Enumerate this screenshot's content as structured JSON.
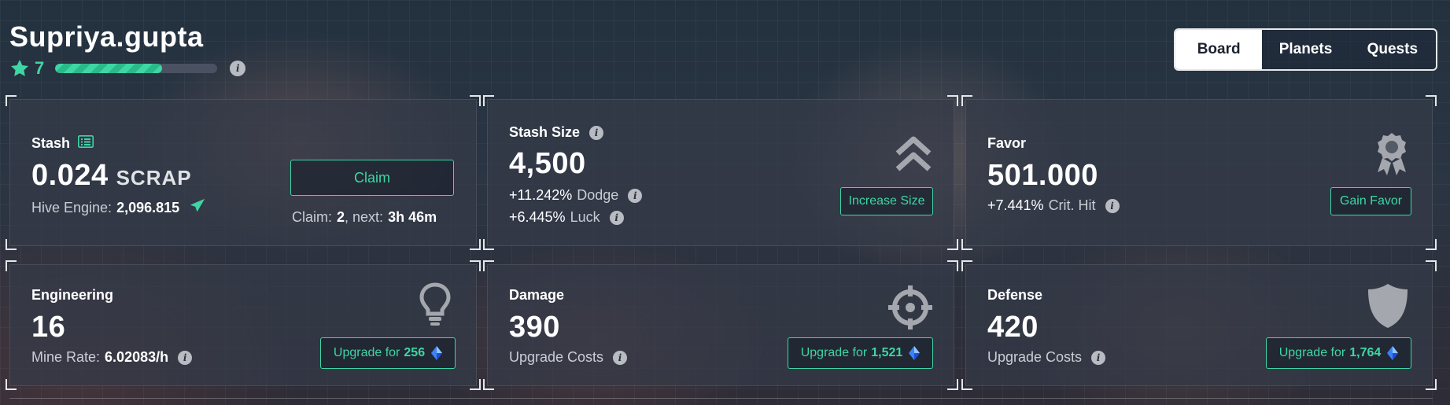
{
  "user": {
    "name": "Supriya.gupta",
    "level": "7",
    "xp_progress": 0.66
  },
  "tabs": [
    {
      "label": "Board",
      "active": true
    },
    {
      "label": "Planets",
      "active": false
    },
    {
      "label": "Quests",
      "active": false
    }
  ],
  "colors": {
    "accent": "#3ed6a4",
    "card_bg": "#343a48",
    "tab_active_bg": "#ffffff"
  },
  "stash": {
    "title": "Stash",
    "value": "0.024",
    "unit": "SCRAP",
    "hive_label": "Hive Engine:",
    "hive_value": "2,096.815",
    "claim_button": "Claim",
    "claim_label": "Claim:",
    "claim_count": "2",
    "next_label": ", next:",
    "next_time": "3h 46m"
  },
  "stash_size": {
    "title": "Stash Size",
    "value": "4,500",
    "dodge_pct": "+11.242%",
    "dodge_label": "Dodge",
    "luck_pct": "+6.445%",
    "luck_label": "Luck",
    "button": "Increase Size"
  },
  "favor": {
    "title": "Favor",
    "value": "501.000",
    "crit_pct": "+7.441%",
    "crit_label": "Crit. Hit",
    "button": "Gain Favor"
  },
  "engineering": {
    "title": "Engineering",
    "value": "16",
    "rate_label": "Mine Rate:",
    "rate_value": "6.02083/h",
    "button_label": "Upgrade for",
    "button_cost": "256"
  },
  "damage": {
    "title": "Damage",
    "value": "390",
    "sub_label": "Upgrade Costs",
    "button_label": "Upgrade for",
    "button_cost": "1,521"
  },
  "defense": {
    "title": "Defense",
    "value": "420",
    "sub_label": "Upgrade Costs",
    "button_label": "Upgrade for",
    "button_cost": "1,764"
  },
  "icons": {
    "stash": "list-icon",
    "hive": "paper-plane-icon",
    "stash_size": "double-chevron-up-icon",
    "favor": "award-badge-icon",
    "engineering": "lightbulb-icon",
    "damage": "crosshair-icon",
    "defense": "shield-icon",
    "cost": "gem-icon",
    "level": "star-icon"
  }
}
